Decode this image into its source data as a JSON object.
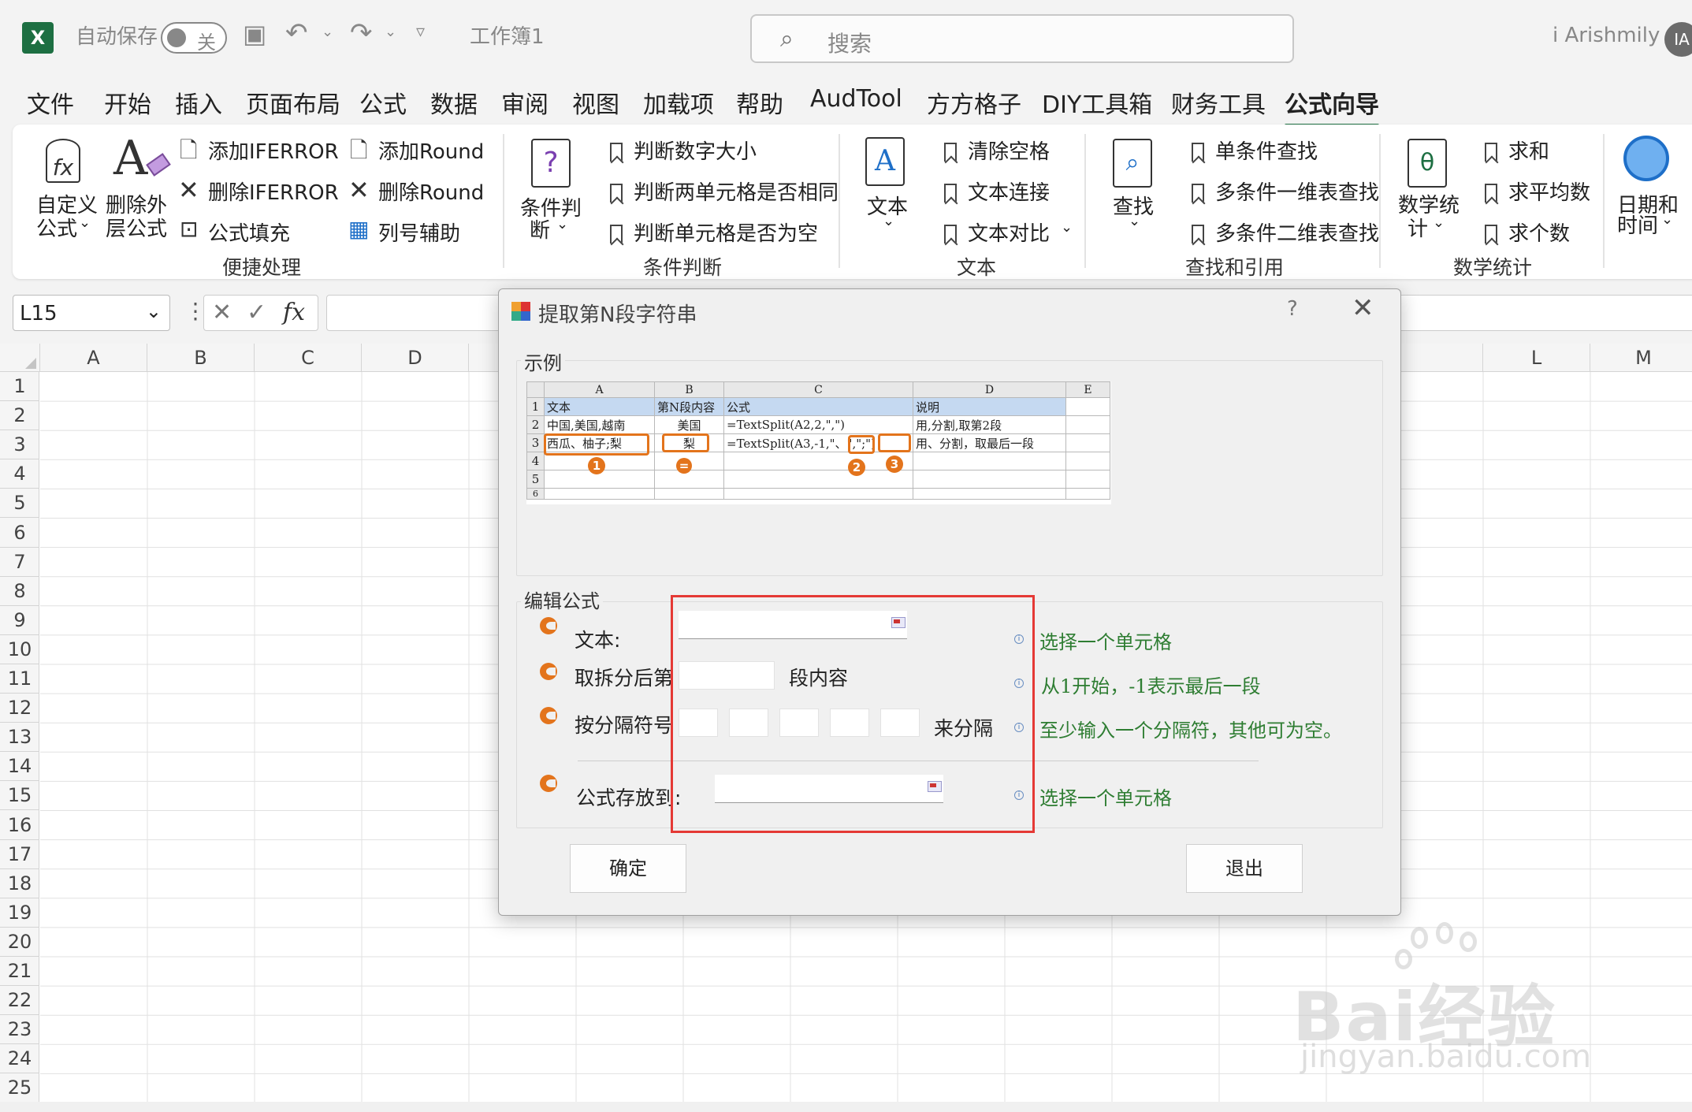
{
  "titlebar": {
    "autosave_label": "自动保存",
    "autosave_state": "关",
    "doc_name": "工作簿1",
    "search_placeholder": "搜索",
    "user_name": "i Arishmily",
    "user_initials": "IA"
  },
  "menu_tabs": [
    "文件",
    "开始",
    "插入",
    "页面布局",
    "公式",
    "数据",
    "审阅",
    "视图",
    "加载项",
    "帮助",
    "AudTool",
    "方方格子",
    "DIY工具箱",
    "财务工具",
    "公式向导"
  ],
  "menu_active": "公式向导",
  "ribbon": {
    "custom_formula": [
      "自定义",
      "公式"
    ],
    "remove_outer": [
      "删除外",
      "层公式"
    ],
    "add_iferror": "添加IFERROR",
    "del_iferror": "删除IFERROR",
    "formula_fill": "公式填充",
    "add_round": "添加Round",
    "del_round": "删除Round",
    "col_assist": "列号辅助",
    "grp_quick": "便捷处理",
    "cond_judge": [
      "条件判",
      "断"
    ],
    "judge_num": "判断数字大小",
    "judge_same": "判断两单元格是否相同",
    "judge_empty": "判断单元格是否为空",
    "grp_cond": "条件判断",
    "text": "文本",
    "clear_space": "清除空格",
    "text_join": "文本连接",
    "text_compare": "文本对比",
    "grp_text": "文本",
    "lookup": "查找",
    "single_lookup": "单条件查找",
    "multi_1d": "多条件一维表查找",
    "multi_2d": "多条件二维表查找",
    "grp_lookup": "查找和引用",
    "math_stats": [
      "数学统",
      "计"
    ],
    "sum": "求和",
    "average": "求平均数",
    "count": "求个数",
    "grp_math": "数学统计",
    "datetime": [
      "日期和",
      "时间"
    ]
  },
  "formula_bar": {
    "name_box": "L15",
    "fx": "fx"
  },
  "sheet": {
    "columns_left": [
      "A",
      "B",
      "C",
      "D"
    ],
    "columns_right": [
      "L",
      "M"
    ],
    "rows": [
      "1",
      "2",
      "3",
      "4",
      "5",
      "6",
      "7",
      "8",
      "9",
      "10",
      "11",
      "12",
      "13",
      "14",
      "15",
      "16",
      "17",
      "18",
      "19",
      "20",
      "21",
      "22",
      "23",
      "24",
      "25"
    ]
  },
  "dialog": {
    "title": "提取第N段字符串",
    "help": "?",
    "example_label": "示例",
    "example_table": {
      "col_headers": [
        "",
        "A",
        "B",
        "C",
        "D",
        "E"
      ],
      "rows": [
        [
          "1",
          "文本",
          "第N段内容",
          "公式",
          "说明",
          ""
        ],
        [
          "2",
          "中国,美国,越南",
          "美国",
          "=TextSplit(A2,2,\",\")",
          "用,分割,取第2段",
          ""
        ],
        [
          "3",
          "西瓜、柚子;梨",
          "梨",
          "=TextSplit(A3,-1,\"、\",\";\")",
          "用、分割，取最后一段",
          ""
        ],
        [
          "4",
          "",
          "",
          "",
          "",
          ""
        ],
        [
          "5",
          "",
          "",
          "",
          "",
          ""
        ],
        [
          "6",
          "",
          "",
          "",
          "",
          ""
        ]
      ],
      "markers": [
        "1",
        "=",
        "2",
        "3"
      ]
    },
    "edit_label": "编辑公式",
    "text_label": "文本:",
    "nth_label": "取拆分后第",
    "nth_suffix": "段内容",
    "sep_label": "按分隔符号",
    "sep_suffix": "来分隔",
    "dest_label": "公式存放到:",
    "hint_text": "选择一个单元格",
    "hint_nth": "从1开始，-1表示最后一段",
    "hint_sep": "至少输入一个分隔符，其他可为空。",
    "hint_dest": "选择一个单元格",
    "ok_label": "确定",
    "exit_label": "退出"
  },
  "watermark": {
    "logo": "Bai经验",
    "url": "jingyan.baidu.com"
  },
  "colors": {
    "accent": "#1d6f42",
    "orange": "#e3741c",
    "hint_green": "#2e7d32",
    "highlight_red": "#e53935"
  }
}
